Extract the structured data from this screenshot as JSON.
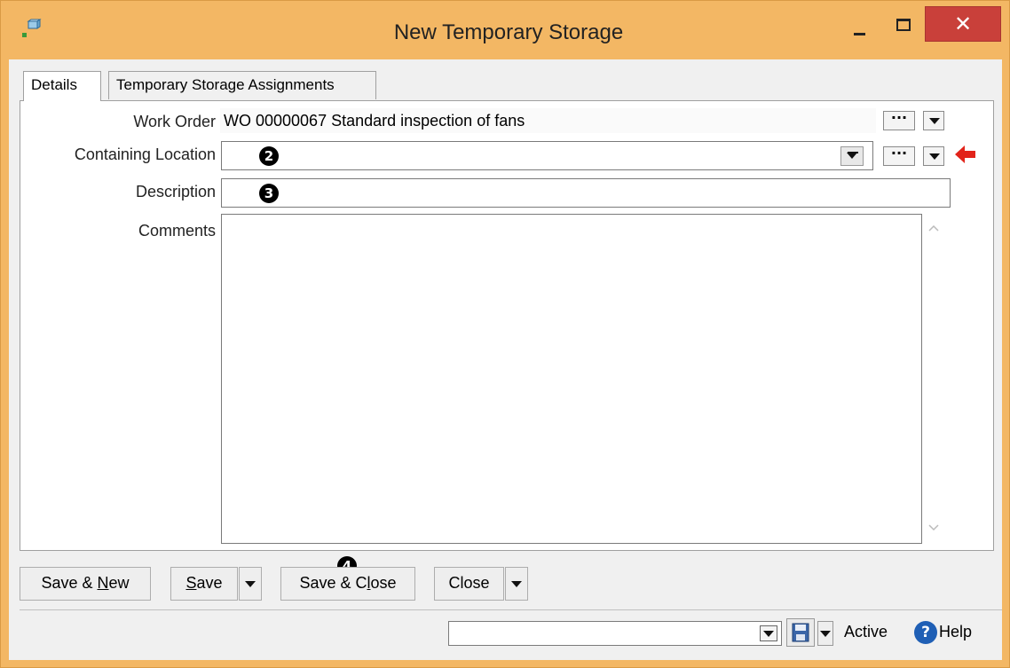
{
  "window": {
    "title": "New Temporary Storage",
    "close_glyph": "✕",
    "accent_color": "#f3b764",
    "close_color": "#c9403a"
  },
  "tabs": [
    {
      "label": "Details",
      "active": true
    },
    {
      "label": "Temporary Storage Assignments",
      "active": false
    }
  ],
  "form": {
    "work_order_label": "Work Order",
    "work_order_value": "WO 00000067    Standard inspection of fans",
    "containing_location_label": "Containing Location",
    "containing_location_value": "",
    "description_label": "Description",
    "description_value": "",
    "comments_label": "Comments",
    "comments_value": "",
    "ellipsis_glyph": "···"
  },
  "markers": {
    "containing_location": "2",
    "description": "3",
    "save_close": "4"
  },
  "buttons": {
    "save_new_prefix": "Save & ",
    "save_new_mnemonic": "N",
    "save_new_suffix": "ew",
    "save_mnemonic": "S",
    "save_suffix": "ave",
    "save_close_prefix": "Save & C",
    "save_close_mnemonic": "l",
    "save_close_suffix": "ose",
    "close_label": "Close"
  },
  "statusbar": {
    "view_select_value": "",
    "status_text": "Active",
    "help_glyph": "?",
    "help_text": "Help"
  },
  "icons": {
    "app": "storage-box-icon",
    "pointer": "red-arrow-left-icon",
    "save": "floppy-disk-icon",
    "help": "help-circle-icon"
  }
}
